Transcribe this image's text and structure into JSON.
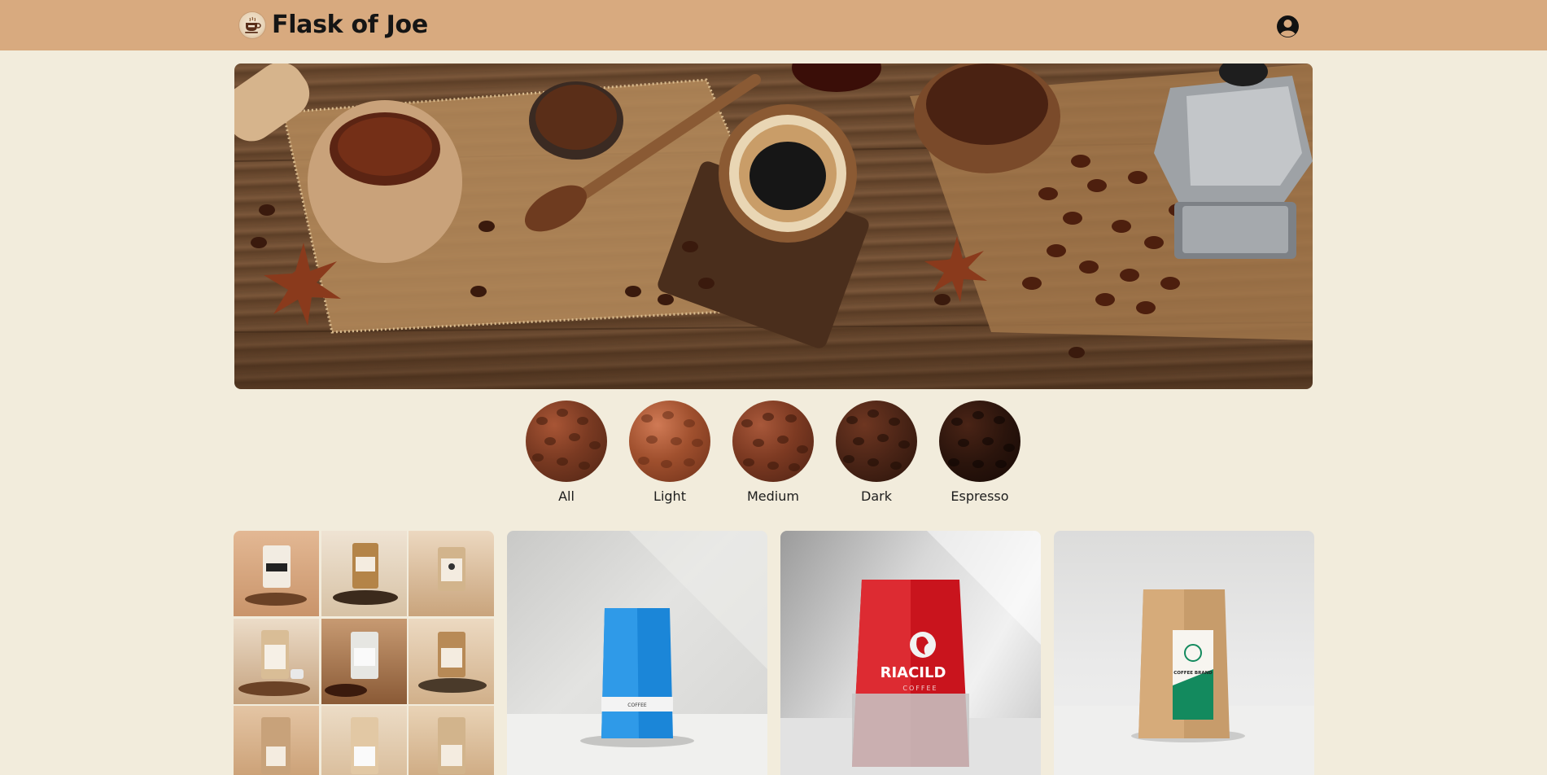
{
  "header": {
    "brand_name": "Flask of Joe",
    "logo_icon": "coffee-cup-logo-icon",
    "account_icon": "user-circle-icon",
    "background_color": "#d8aa7f"
  },
  "hero": {
    "image_subject": "coffee-beans-hero-image"
  },
  "roast_filters": [
    {
      "label": "All",
      "color": "#7a3a22"
    },
    {
      "label": "Light",
      "color": "#9c4a2a"
    },
    {
      "label": "Medium",
      "color": "#7d3a22"
    },
    {
      "label": "Dark",
      "color": "#4a2416"
    },
    {
      "label": "Espresso",
      "color": "#2a140c"
    }
  ],
  "products": [
    {
      "image": "coffee-bags-collage"
    },
    {
      "image": "blue-coffee-bag",
      "bag_text": "COFFEE"
    },
    {
      "image": "red-coffee-bag",
      "bag_text": "RIACILD",
      "bag_subtext": "COFFEE"
    },
    {
      "image": "kraft-coffee-bag",
      "bag_text": "COFFEE BRAND"
    }
  ],
  "colors": {
    "page_background": "#f2ecdc",
    "text": "#1d1d1d"
  }
}
